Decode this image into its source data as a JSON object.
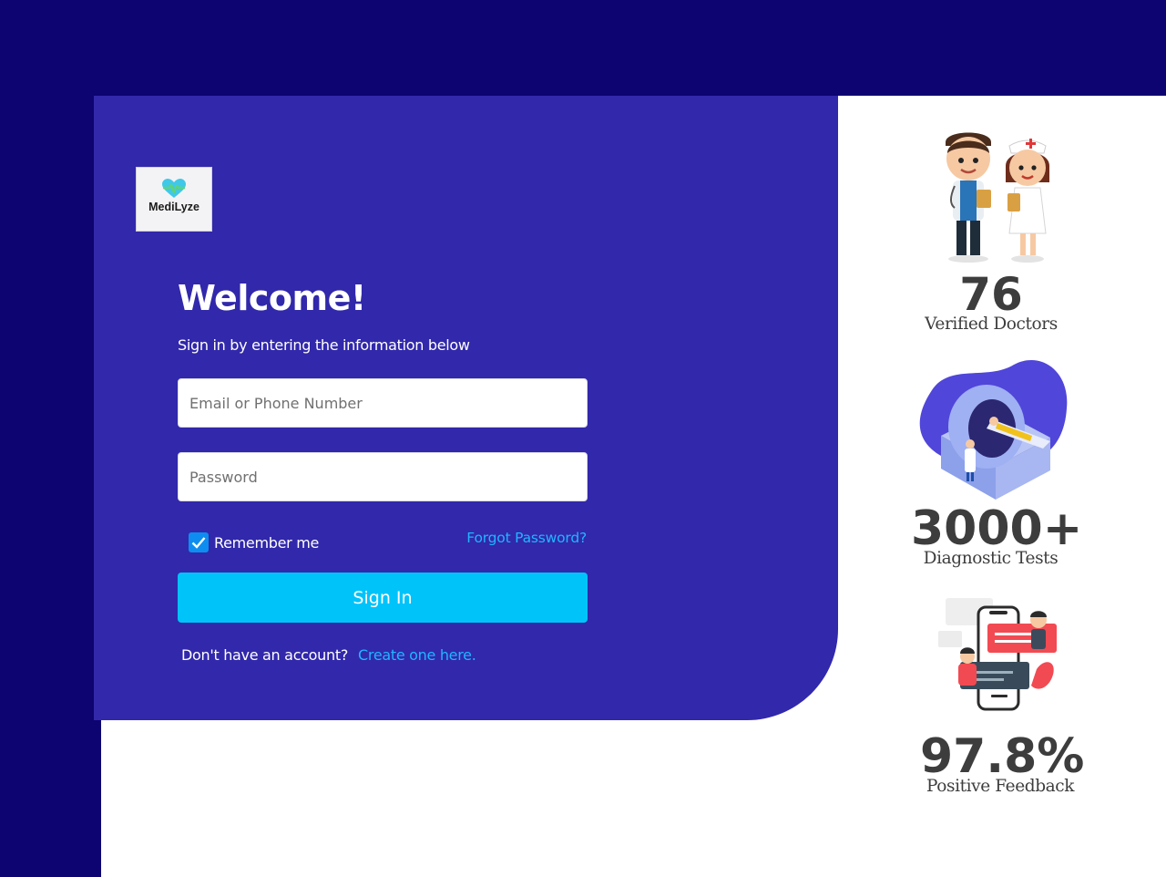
{
  "app": {
    "brand": "MediLyze"
  },
  "login": {
    "title": "Welcome!",
    "subtitle": "Sign in by entering the information below",
    "email_placeholder": "Email or Phone Number",
    "password_placeholder": "Password",
    "remember_label": "Remember me",
    "remember_checked": true,
    "forgot_label": "Forgot Password?",
    "signin_label": "Sign In",
    "no_account_text": "Don't have an account?",
    "create_link": "Create one here."
  },
  "stats": [
    {
      "value": "76",
      "label": "Verified Doctors",
      "icon": "doctors-illustration-icon"
    },
    {
      "value": "3000+",
      "label": "Diagnostic Tests",
      "icon": "mri-scanner-illustration-icon"
    },
    {
      "value": "97.8%",
      "label": "Positive Feedback",
      "icon": "chat-feedback-illustration-icon"
    }
  ],
  "colors": {
    "background": "#0d0371",
    "panel": "#3128ab",
    "accent": "#00c3fa",
    "link": "#21b5ff",
    "stat_text": "#3d3d3d"
  }
}
